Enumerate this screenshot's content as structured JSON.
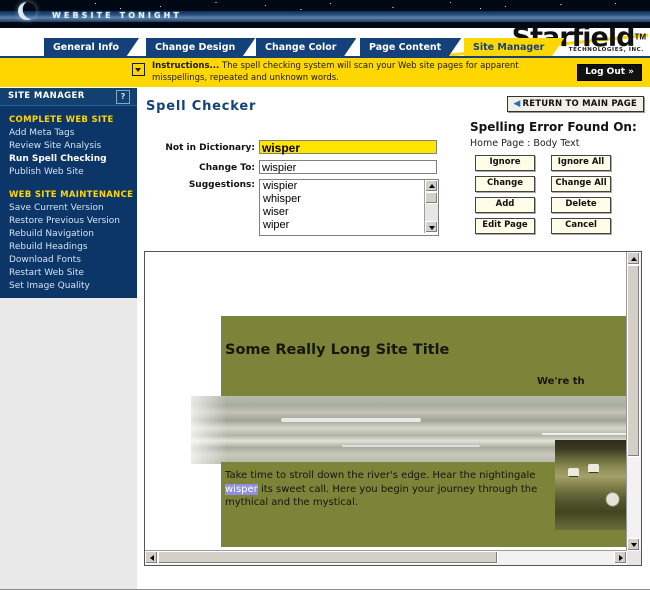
{
  "brand": {
    "suite_name": "WEBSITE TONIGHT",
    "logo_main": "Starfield",
    "logo_tm": "TM",
    "logo_sub": "TECHNOLOGIES, INC.",
    "moon_icon": "crescent-moon-icon"
  },
  "tabs": [
    {
      "label": "General Info",
      "active": false
    },
    {
      "label": "Change Design",
      "active": false
    },
    {
      "label": "Change Color",
      "active": false
    },
    {
      "label": "Page Content",
      "active": false
    },
    {
      "label": "Site Manager",
      "active": true
    }
  ],
  "instructions": {
    "toggle_icon": "chevron-down-icon",
    "heading": "Instructions...",
    "text": " The spell checking system will scan your Web site pages for apparent misspellings, repeated and unknown words.",
    "logout_label": "Log Out »"
  },
  "sidebar": {
    "header": "SITE MANAGER",
    "help_label": "?",
    "groups": [
      {
        "title": "COMPLETE WEB SITE",
        "items": [
          {
            "label": "Add Meta Tags",
            "current": false
          },
          {
            "label": "Review Site Analysis",
            "current": false
          },
          {
            "label": "Run Spell Checking",
            "current": true
          },
          {
            "label": "Publish Web Site",
            "current": false
          }
        ]
      },
      {
        "title": "WEB SITE MAINTENANCE",
        "items": [
          {
            "label": "Save Current Version",
            "current": false
          },
          {
            "label": "Restore Previous Version",
            "current": false
          },
          {
            "label": "Rebuild Navigation",
            "current": false
          },
          {
            "label": "Rebuild Headings",
            "current": false
          },
          {
            "label": "Download Fonts",
            "current": false
          },
          {
            "label": "Restart Web Site",
            "current": false
          },
          {
            "label": "Set Image Quality",
            "current": false
          }
        ]
      }
    ]
  },
  "main": {
    "page_title": "Spell Checker",
    "return_button": "RETURN TO MAIN PAGE",
    "return_arrow_icon": "arrow-left-icon",
    "form": {
      "not_in_dictionary_label": "Not in Dictionary:",
      "not_in_dictionary_value": "wisper",
      "change_to_label": "Change To:",
      "change_to_value": "wispier",
      "suggestions_label": "Suggestions:",
      "suggestions": [
        "wispier",
        "whisper",
        "wiser",
        "wiper"
      ]
    },
    "error_panel": {
      "title": "Spelling Error Found On:",
      "location": "Home Page : Body Text",
      "buttons": [
        "Ignore",
        "Ignore All",
        "Change",
        "Change All",
        "Add",
        "Delete",
        "Edit Page",
        "Cancel"
      ]
    }
  },
  "preview": {
    "site_title": "Some Really Long Site Title",
    "tagline": "We're th",
    "body_text_before": "Take time to stroll down the river's edge. Hear the nightingale ",
    "body_text_highlight": "wisper",
    "body_text_after": " its sweet call. Here you begin your journey through the mythical and the mystical.",
    "banner_color": "#7d8439",
    "highlight_color": "#8f8fe0",
    "photo_band_alt": "cloudy-landscape-image",
    "thumbnail_alt": "golf-course-photo"
  },
  "colors": {
    "navy": "#14417a",
    "sidebar_navy": "#0d3668",
    "accent_yellow": "#ffd700",
    "olive": "#7d8439"
  }
}
